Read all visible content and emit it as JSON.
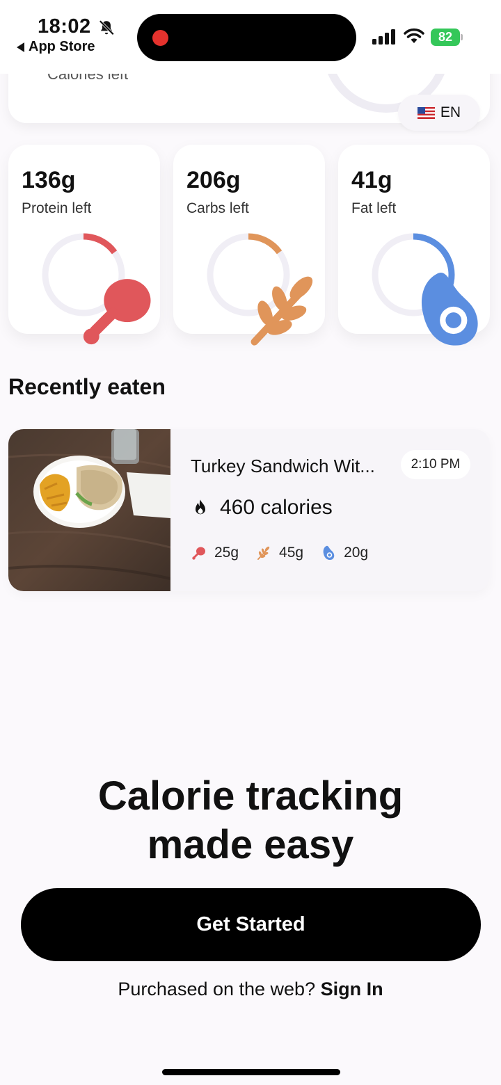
{
  "status_bar": {
    "time": "18:02",
    "back_label": "App Store",
    "battery": "82"
  },
  "calorie_card": {
    "label": "Calories left"
  },
  "language": {
    "code": "EN"
  },
  "macros": [
    {
      "value": "136g",
      "label": "Protein left",
      "color": "#e0575b",
      "progress": 0.15
    },
    {
      "value": "206g",
      "label": "Carbs left",
      "color": "#e0955a",
      "progress": 0.15
    },
    {
      "value": "41g",
      "label": "Fat left",
      "color": "#5b8ee0",
      "progress": 0.38
    }
  ],
  "recent": {
    "title": "Recently eaten",
    "item": {
      "name": "Turkey Sandwich Wit...",
      "time": "2:10 PM",
      "calories": "460 calories",
      "protein": "25g",
      "carbs": "45g",
      "fat": "20g"
    }
  },
  "hero": {
    "line1": "Calorie tracking",
    "line2": "made easy",
    "cta": "Get Started",
    "signin_prompt": "Purchased on the web?",
    "signin_link": "Sign In"
  }
}
